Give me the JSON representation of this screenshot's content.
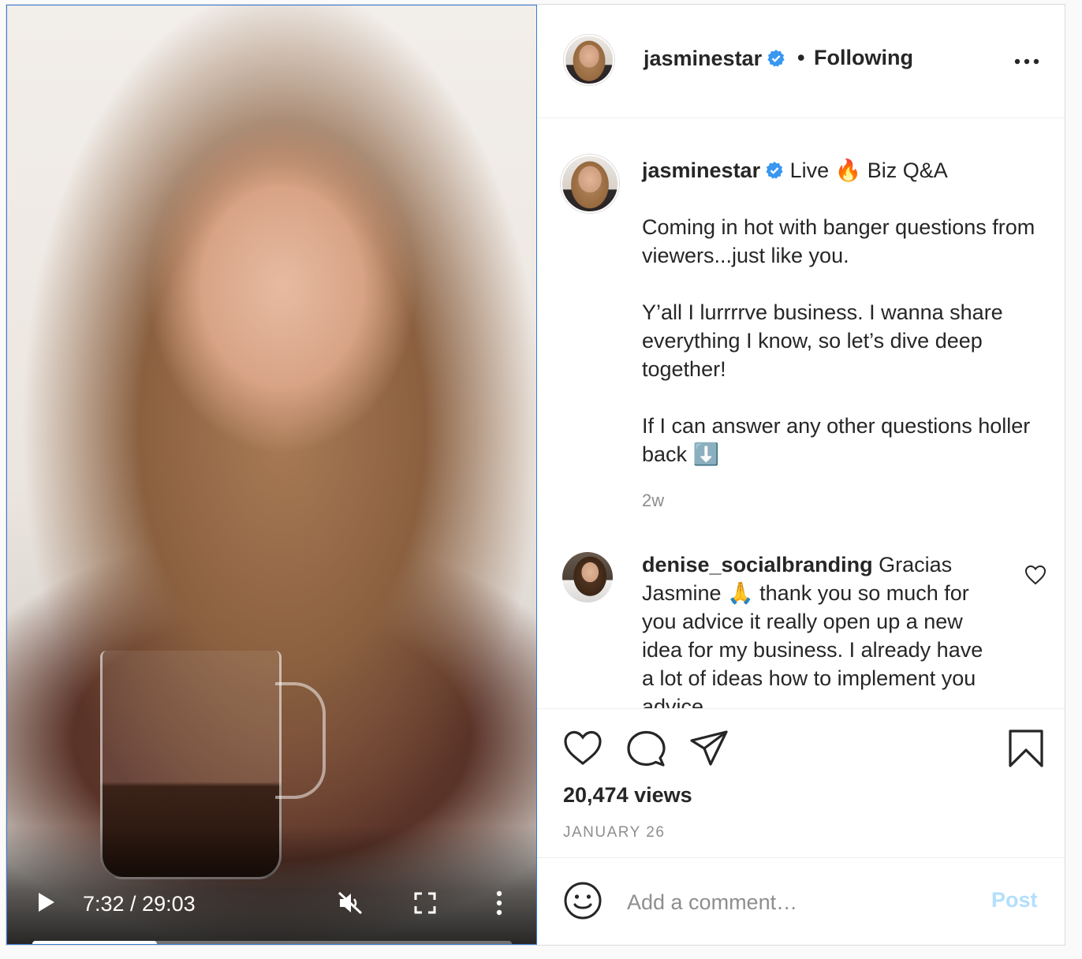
{
  "video": {
    "time": "7:32 / 29:03",
    "progress": 0.26,
    "state": "paused",
    "muted": true
  },
  "header": {
    "username": "jasminestar",
    "separator": "•",
    "follow_label": "Following"
  },
  "caption": {
    "username": "jasminestar",
    "title": "Live 🔥 Biz Q&A",
    "paragraphs": [
      "Coming in hot with banger questions from viewers...just like you.",
      "Y’all I lurrrrve business. I wanna share everything I know, so let’s dive deep together!",
      "If I can answer any other questions holler back ⬇️"
    ],
    "timestamp": "2w"
  },
  "comment": {
    "username": "denise_socialbranding",
    "text": "Gracias Jasmine 🙏 thank you so much for you advice it really open up a new idea for my business. I already have a lot of ideas how to implement you advice"
  },
  "stats": {
    "views": "20,474 views",
    "date": "JANUARY 26"
  },
  "comment_box": {
    "placeholder": "Add a comment…",
    "post_label": "Post"
  },
  "colors": {
    "verified": "#3897f0",
    "post_disabled": "#b2dffc",
    "secondary_text": "#8e8e8e",
    "border": "#dbdbdb"
  },
  "icons": [
    "play-icon",
    "muted-speaker-icon",
    "fullscreen-icon",
    "more-vertical-icon",
    "verified-icon",
    "more-horizontal-icon",
    "heart-icon",
    "comment-icon",
    "share-icon",
    "bookmark-icon",
    "emoji-icon"
  ]
}
